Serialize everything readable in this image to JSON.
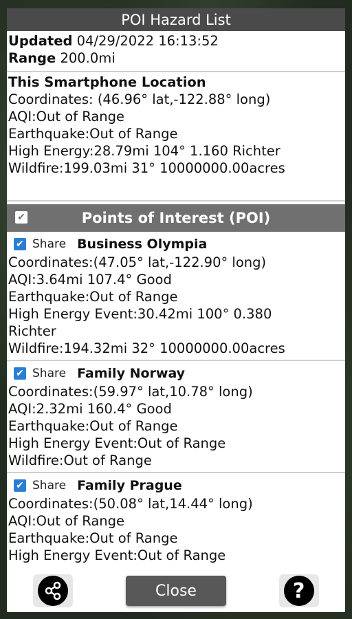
{
  "title": "POI Hazard List",
  "updated": {
    "label": "Updated",
    "value": "04/29/2022 16:13:52"
  },
  "range": {
    "label": "Range",
    "value": "200.0mi"
  },
  "phone": {
    "title": "This Smartphone Location",
    "lines": [
      "Coordinates: (46.96° lat,-122.88° long)",
      "AQI:Out of Range",
      "Earthquake:Out of Range",
      "High Energy:28.79mi  104° 1.160 Richter",
      "Wildfire:199.03mi   31° 10000000.00acres"
    ]
  },
  "poi_header": {
    "title": "Points of Interest (POI)",
    "checked": true
  },
  "poi_items": [
    {
      "share_label": "Share",
      "name": "Business Olympia",
      "lines": [
        "Coordinates:(47.05° lat,-122.90° long)",
        "AQI:3.64mi 107.4° Good",
        "Earthquake:Out of Range",
        "High Energy Event:30.42mi  100° 0.380",
        "Richter",
        "Wildfire:194.32mi   32° 10000000.00acres"
      ]
    },
    {
      "share_label": "Share",
      "name": "Family Norway",
      "lines": [
        "Coordinates:(59.97° lat,10.78° long)",
        "AQI:2.32mi 160.4° Good",
        "Earthquake:Out of Range",
        "High Energy Event:Out of Range",
        "Wildfire:Out of Range"
      ]
    },
    {
      "share_label": "Share",
      "name": "Family Prague",
      "lines": [
        "Coordinates:(50.08° lat,14.44° long)",
        "AQI:Out of Range",
        "Earthquake:Out of Range",
        "High Energy Event:Out of Range"
      ]
    }
  ],
  "footer": {
    "close_label": "Close",
    "help_glyph": "?",
    "share_icon": "share-icon",
    "help_icon": "help-icon"
  },
  "colors": {
    "title_bar": "#4a4a4a",
    "poi_header": "#707070",
    "checkbox": "#2a7fd4",
    "close_button": "#585858"
  }
}
